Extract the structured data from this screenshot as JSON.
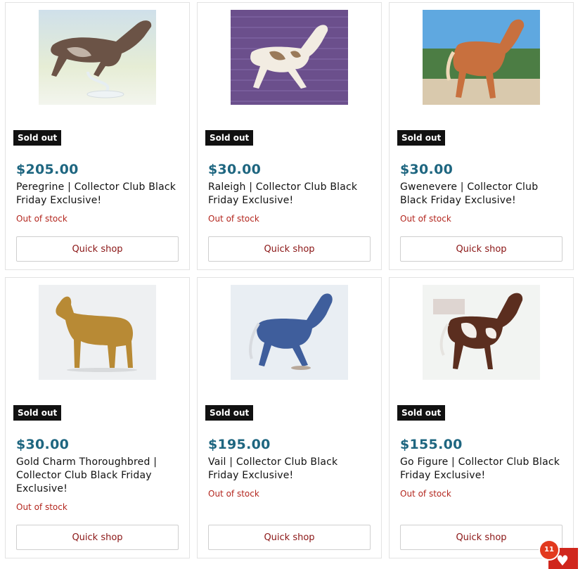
{
  "products": [
    {
      "badge": "Sold out",
      "price": "$205.00",
      "title": "Peregrine | Collector Club Black Friday Exclusive!",
      "stock": "Out of stock",
      "button": "Quick shop"
    },
    {
      "badge": "Sold out",
      "price": "$30.00",
      "title": "Raleigh | Collector Club Black Friday Exclusive!",
      "stock": "Out of stock",
      "button": "Quick shop"
    },
    {
      "badge": "Sold out",
      "price": "$30.00",
      "title": "Gwenevere | Collector Club Black Friday Exclusive!",
      "stock": "Out of stock",
      "button": "Quick shop"
    },
    {
      "badge": "Sold out",
      "price": "$30.00",
      "title": "Gold Charm Thoroughbred | Collector Club Black Friday Exclusive!",
      "stock": "Out of stock",
      "button": "Quick shop"
    },
    {
      "badge": "Sold out",
      "price": "$195.00",
      "title": "Vail | Collector Club Black Friday Exclusive!",
      "stock": "Out of stock",
      "button": "Quick shop"
    },
    {
      "badge": "Sold out",
      "price": "$155.00",
      "title": "Go Figure | Collector Club Black Friday Exclusive!",
      "stock": "Out of stock",
      "button": "Quick shop"
    }
  ],
  "wishlist": {
    "count": "11",
    "icon": "heart-icon"
  },
  "colors": {
    "price": "#1e6680",
    "stock": "#b3261e",
    "button_text": "#8a1414",
    "badge_bg": "#111111",
    "fab": "#d0271d"
  }
}
